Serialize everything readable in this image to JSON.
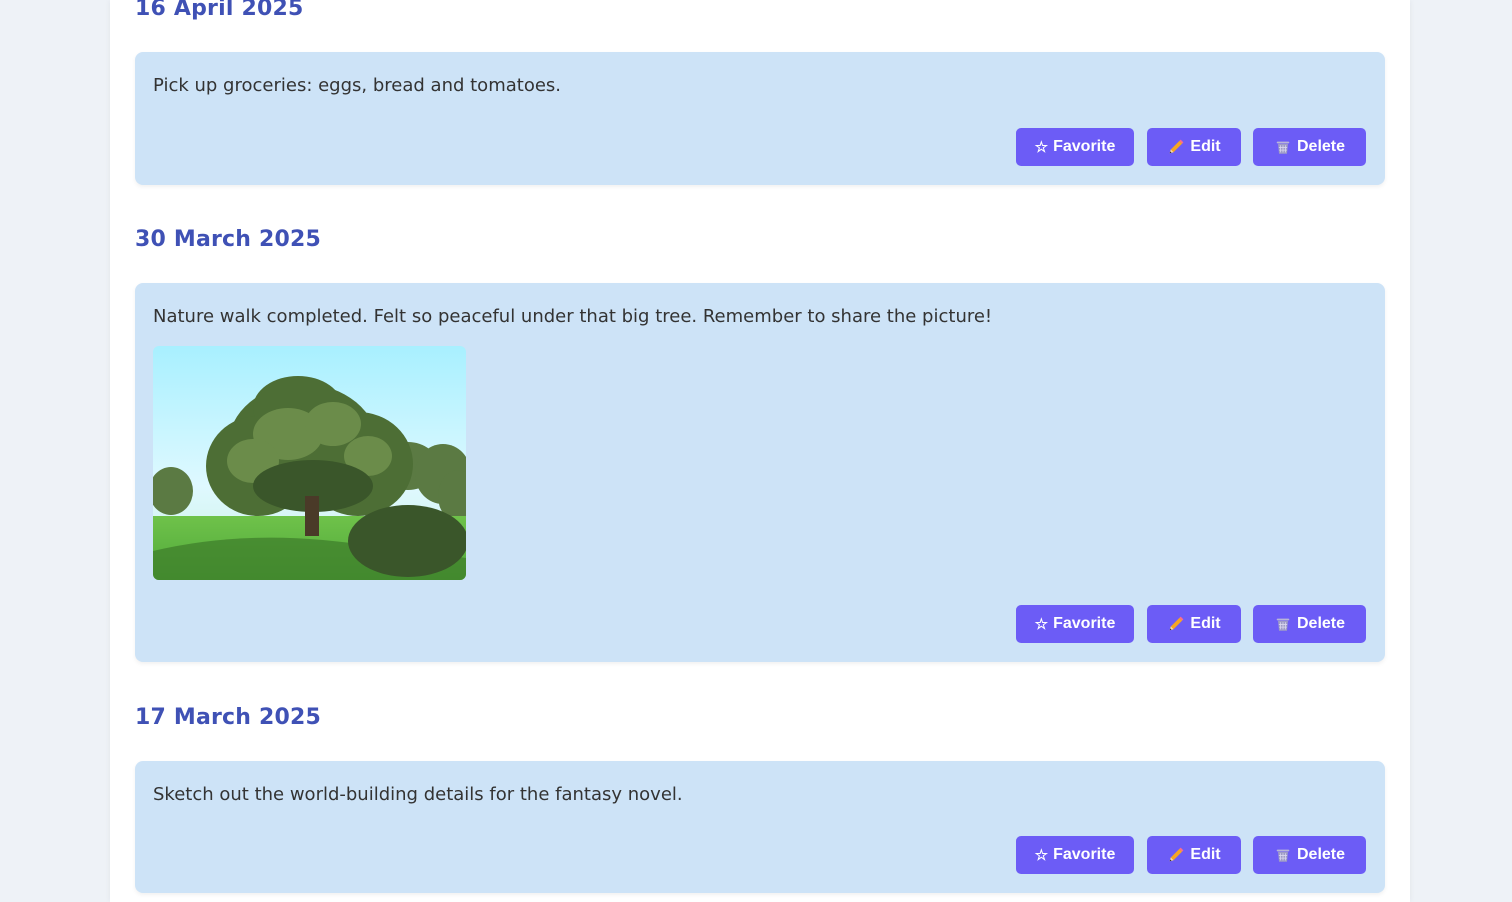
{
  "entries": [
    {
      "date": "16 April 2025",
      "text": "Pick up groceries: eggs, bread and tomatoes.",
      "has_photo": false
    },
    {
      "date": "30 March 2025",
      "text": "Nature walk completed. Felt so peaceful under that big tree. Remember to share the picture!",
      "has_photo": true,
      "photo_subject": "large green tree in a sunny meadow"
    },
    {
      "date": "17 March 2025",
      "text": "Sketch out the world-building details for the fantasy novel.",
      "has_photo": false
    }
  ],
  "actions": {
    "favorite_label": "Favorite",
    "edit_label": "Edit",
    "delete_label": "Delete",
    "favorite_icon": "star-icon",
    "edit_icon": "pencil-icon",
    "delete_icon": "trash-icon"
  },
  "colors": {
    "date_heading": "#3f51b5",
    "card_background": "#cde3f7",
    "button_background": "#6c5cf6",
    "page_background": "#eef2f7"
  }
}
